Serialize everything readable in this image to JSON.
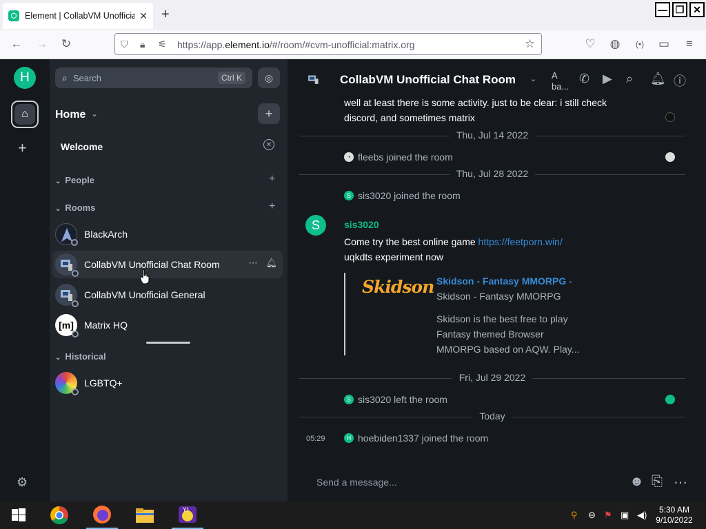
{
  "browser": {
    "tab_title": "Element | CollabVM Unofficial C",
    "tab_close": "✕",
    "new_tab": "+",
    "url_prefix": "https://app.",
    "url_domain": "element.io",
    "url_path": "/#/room/#cvm-unofficial:matrix.org",
    "window_buttons": [
      "—",
      "❐",
      "✕"
    ]
  },
  "spaces": {
    "user_initial": "H"
  },
  "left": {
    "search_placeholder": "Search",
    "search_shortcut": "Ctrl K",
    "home_title": "Home",
    "welcome": "Welcome",
    "sections": {
      "people": "People",
      "rooms": "Rooms",
      "historical": "Historical"
    },
    "rooms": [
      {
        "name": "BlackArch",
        "avatar": "#1a1f2e"
      },
      {
        "name": "CollabVM Unofficial Chat Room",
        "avatar": "#3b4556"
      },
      {
        "name": "CollabVM Unofficial General",
        "avatar": "#3b4556"
      },
      {
        "name": "Matrix HQ",
        "avatar": "#ffffff",
        "initial": "m"
      }
    ],
    "historical_rooms": [
      {
        "name": "LGBTQ+",
        "avatar": "#d9412b"
      }
    ]
  },
  "room": {
    "name": "CollabVM Unofficial Chat Room",
    "topic": "A ba...",
    "messages": {
      "first_text": "well at least there is some activity. just to be clear: i still check discord, and sometimes matrix",
      "sep1": "Thu, Jul 14 2022",
      "event1": "fleebs joined the room",
      "sep2": "Thu, Jul 28 2022",
      "event2": "sis3020 joined the room",
      "sender": "sis3020",
      "sender_initial": "S",
      "msg_prefix": "Come try the best online game ",
      "msg_link": "https://feetporn.win/",
      "msg_line2": "uqkdts experiment now",
      "preview_logo": "Skidson",
      "preview_title": "Skidson - Fantasy MMORPG",
      "preview_title_suffix": " -",
      "preview_site": "Skidson - Fantasy MMORPG",
      "preview_desc": "Skidson is the best free to play Fantasy themed Browser MMORPG based on AQW. Play...",
      "sep3": "Fri, Jul 29 2022",
      "event3": "sis3020 left the room",
      "sep4": "Today",
      "event4_time": "05:29",
      "event4": "hoebiden1337 joined the room"
    },
    "composer_placeholder": "Send a message..."
  },
  "taskbar": {
    "time": "5:30 AM",
    "date": "9/10/2022"
  },
  "colors": {
    "accent": "#0dbd8b",
    "link": "#368bd6",
    "sidebar_bg": "#21262c",
    "timeline_bg": "#15191e"
  }
}
